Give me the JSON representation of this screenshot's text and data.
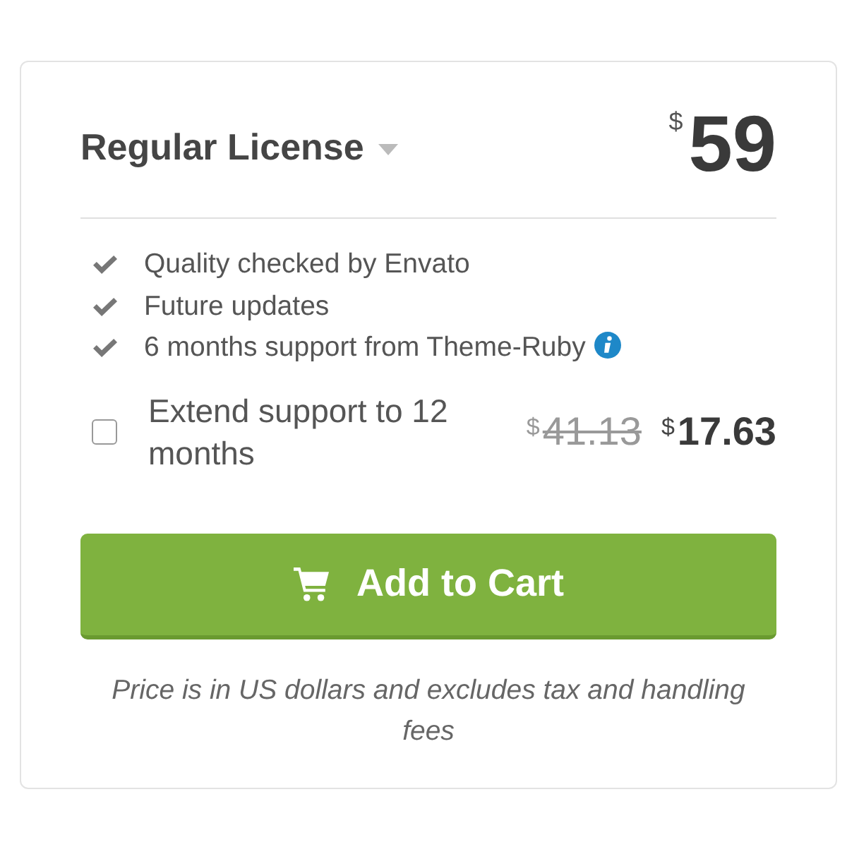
{
  "license": {
    "title": "Regular License",
    "currency": "$",
    "price": "59"
  },
  "features": [
    {
      "text": "Quality checked by Envato",
      "info": false
    },
    {
      "text": "Future updates",
      "info": false
    },
    {
      "text": "6 months support from Theme-Ruby",
      "info": true
    }
  ],
  "extended_support": {
    "label": "Extend support to 12 months",
    "checked": false,
    "old_currency": "$",
    "old_price": "41.13",
    "currency": "$",
    "price": "17.63"
  },
  "add_to_cart": {
    "label": "Add to Cart"
  },
  "note": "Price is in US dollars and excludes tax and handling fees"
}
